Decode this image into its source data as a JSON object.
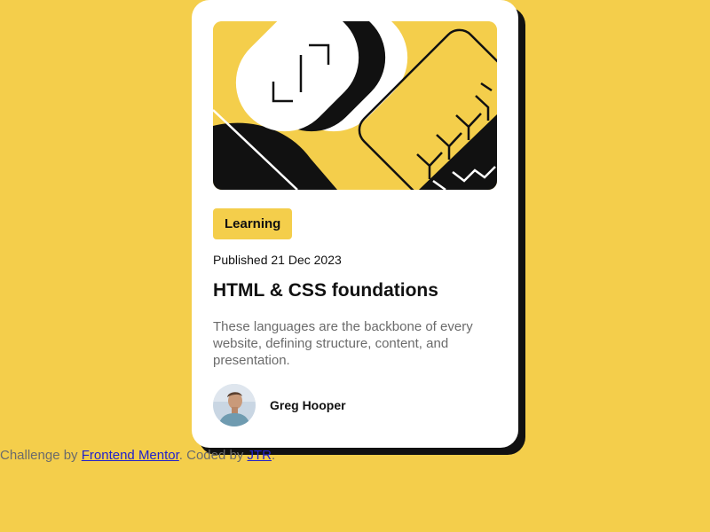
{
  "card": {
    "hero_image_alt": "abstract illustration",
    "tag": "Learning",
    "published": "Published 21 Dec 2023",
    "title": "HTML & CSS foundations",
    "description": "These languages are the backbone of every website, defining structure, content, and presentation.",
    "author": {
      "name": "Greg Hooper",
      "avatar_icon": "person-avatar-icon"
    }
  },
  "attribution": {
    "prefix": "Challenge by ",
    "link1": "Frontend Mentor",
    "middle": ". Coded by ",
    "link2": "JTR",
    "suffix": "."
  },
  "colors": {
    "background": "#F4CE4B",
    "card": "#FFFFFF",
    "ink": "#111111",
    "muted_text": "#6B6B6B",
    "link": "#2222CC"
  }
}
